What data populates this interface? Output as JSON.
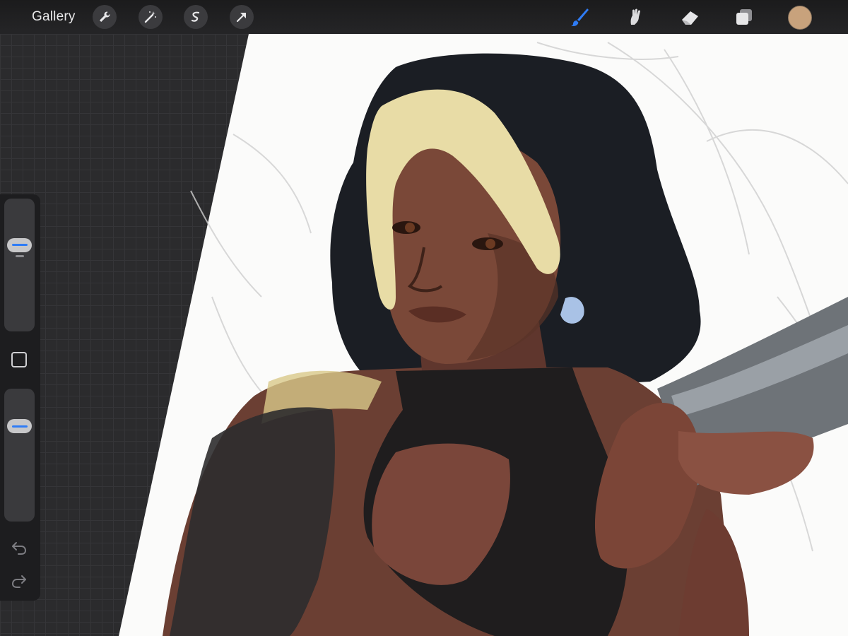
{
  "toolbar": {
    "gallery_label": "Gallery",
    "left_tools": [
      "wrench-icon",
      "magic-wand-icon",
      "selection-icon",
      "transform-arrow-icon"
    ],
    "right_tools": [
      "brush-icon",
      "smudge-icon",
      "eraser-icon",
      "layers-icon"
    ],
    "active_tool": "brush-icon",
    "current_color": "#c8a27c",
    "accent_color": "#2f7cf6"
  },
  "sidebar": {
    "brush_size_level": 0.68,
    "opacity_level": 0.76,
    "icons": [
      "modifier-square-icon",
      "undo-icon",
      "redo-icon"
    ]
  }
}
